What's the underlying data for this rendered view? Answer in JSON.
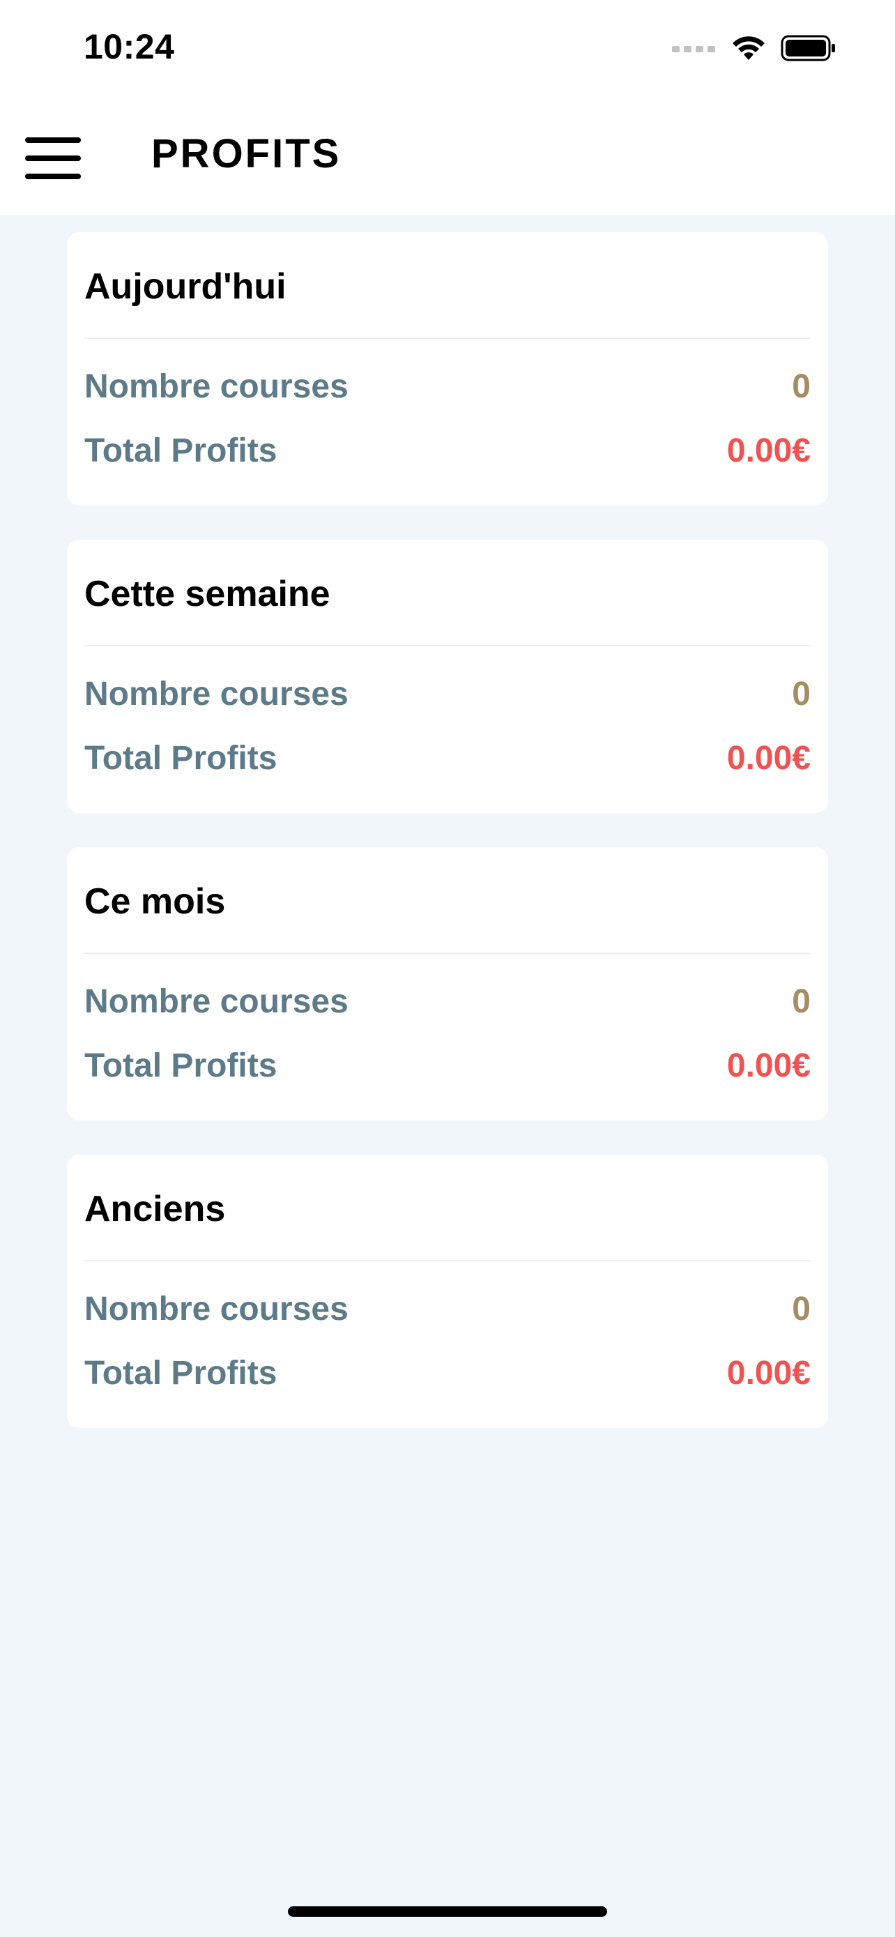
{
  "status_bar": {
    "time": "10:24",
    "icons": [
      "signal-icon",
      "wifi-icon",
      "battery-icon"
    ]
  },
  "header": {
    "title": "PROFITS",
    "menu_icon": "hamburger-menu-icon"
  },
  "colors": {
    "background": "#f0f6fa",
    "label": "#5d7a88",
    "count": "#a58d63",
    "profit": "#f05252"
  },
  "cards": [
    {
      "title": "Aujourd'hui",
      "count_label": "Nombre courses",
      "count_value": "0",
      "profit_label": "Total Profits",
      "profit_value": "0.00€"
    },
    {
      "title": "Cette semaine",
      "count_label": "Nombre courses",
      "count_value": "0",
      "profit_label": "Total Profits",
      "profit_value": "0.00€"
    },
    {
      "title": "Ce mois",
      "count_label": "Nombre courses",
      "count_value": "0",
      "profit_label": "Total Profits",
      "profit_value": "0.00€"
    },
    {
      "title": "Anciens",
      "count_label": "Nombre courses",
      "count_value": "0",
      "profit_label": "Total Profits",
      "profit_value": "0.00€"
    }
  ]
}
